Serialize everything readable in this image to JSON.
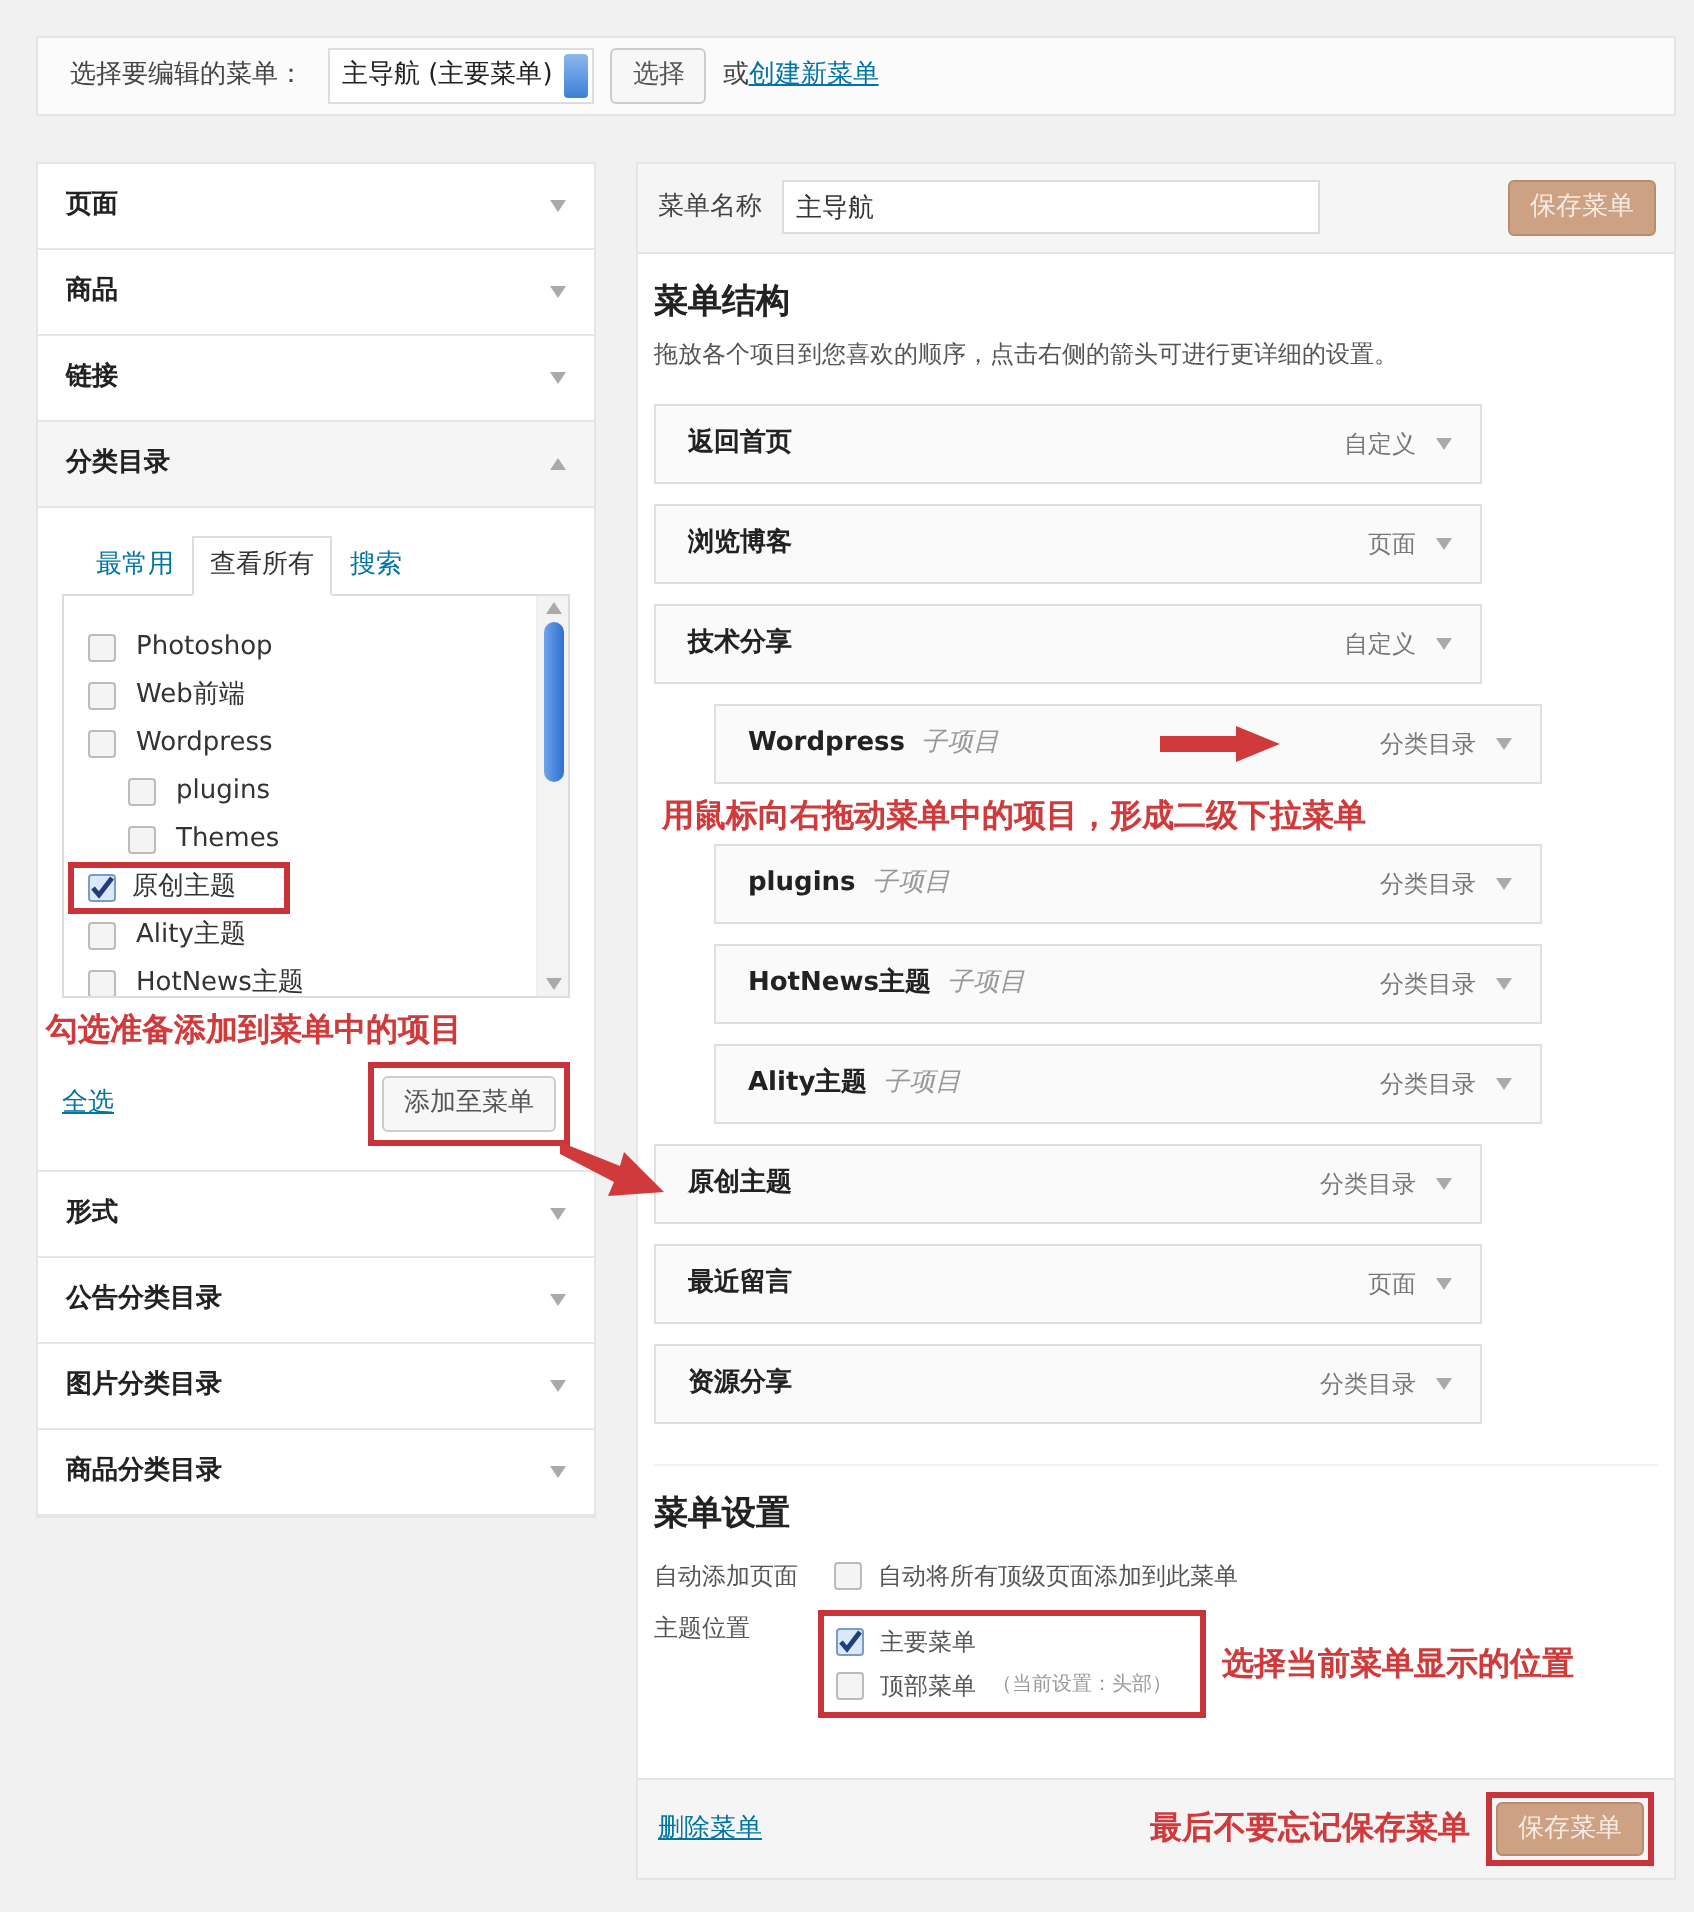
{
  "menu_select": {
    "label": "选择要编辑的菜单：",
    "value": "主导航 (主要菜单)",
    "button": "选择",
    "prefix": "或",
    "link": "创建新菜单"
  },
  "sidebar": {
    "sections": [
      {
        "title": "页面",
        "expanded": false
      },
      {
        "title": "商品",
        "expanded": false
      },
      {
        "title": "链接",
        "expanded": false
      },
      {
        "title": "分类目录",
        "expanded": true
      },
      {
        "title": "形式",
        "expanded": false
      },
      {
        "title": "公告分类目录",
        "expanded": false
      },
      {
        "title": "图片分类目录",
        "expanded": false
      },
      {
        "title": "商品分类目录",
        "expanded": false
      }
    ],
    "category_panel": {
      "tabs": [
        {
          "label": "最常用",
          "selected": false
        },
        {
          "label": "查看所有",
          "selected": true
        },
        {
          "label": "搜索",
          "selected": false
        }
      ],
      "items": [
        {
          "label": "Photoshop",
          "checked": false,
          "highlighted": false
        },
        {
          "label": "Web前端",
          "checked": false,
          "highlighted": false
        },
        {
          "label": "Wordpress",
          "checked": false,
          "highlighted": false,
          "children": [
            {
              "label": "plugins",
              "checked": false,
              "highlighted": false
            },
            {
              "label": "Themes",
              "checked": false,
              "highlighted": false
            }
          ]
        },
        {
          "label": "原创主题",
          "checked": true,
          "highlighted": true
        },
        {
          "label": "Ality主题",
          "checked": false,
          "highlighted": false
        },
        {
          "label": "HotNews主题",
          "checked": false,
          "highlighted": false
        }
      ],
      "annotation": "勾选准备添加到菜单中的项目",
      "select_all": "全选",
      "add_button": "添加至菜单"
    }
  },
  "menu_editor": {
    "name_label": "菜单名称",
    "name_value": "主导航",
    "save_button": "保存菜单",
    "structure_title": "菜单结构",
    "structure_hint": "拖放各个项目到您喜欢的顺序，点击右侧的箭头可进行更详细的设置。",
    "items": [
      {
        "title": "返回首页",
        "type": "自定义"
      },
      {
        "title": "浏览博客",
        "type": "页面"
      },
      {
        "title": "技术分享",
        "type": "自定义",
        "children": [
          {
            "title": "Wordpress",
            "sub": "子项目",
            "type": "分类目录",
            "arrow": true
          },
          {
            "title": "plugins",
            "sub": "子项目",
            "type": "分类目录",
            "annotation": "用鼠标向右拖动菜单中的项目，形成二级下拉菜单"
          },
          {
            "title": "HotNews主题",
            "sub": "子项目",
            "type": "分类目录"
          },
          {
            "title": "Ality主题",
            "sub": "子项目",
            "type": "分类目录"
          }
        ]
      },
      {
        "title": "原创主题",
        "type": "分类目录"
      },
      {
        "title": "最近留言",
        "type": "页面"
      },
      {
        "title": "资源分享",
        "type": "分类目录"
      }
    ]
  },
  "settings": {
    "title": "菜单设置",
    "auto_add": {
      "label": "自动添加页面",
      "option": "自动将所有顶级页面添加到此菜单",
      "checked": false
    },
    "locations": {
      "label": "主题位置",
      "annotation": "选择当前菜单显示的位置",
      "options": [
        {
          "label": "主要菜单",
          "checked": true
        },
        {
          "label": "顶部菜单",
          "note": "（当前设置：头部）",
          "checked": false
        }
      ]
    }
  },
  "footer": {
    "delete_link": "删除菜单",
    "annotation": "最后不要忘记保存菜单",
    "save_button": "保存菜单"
  }
}
